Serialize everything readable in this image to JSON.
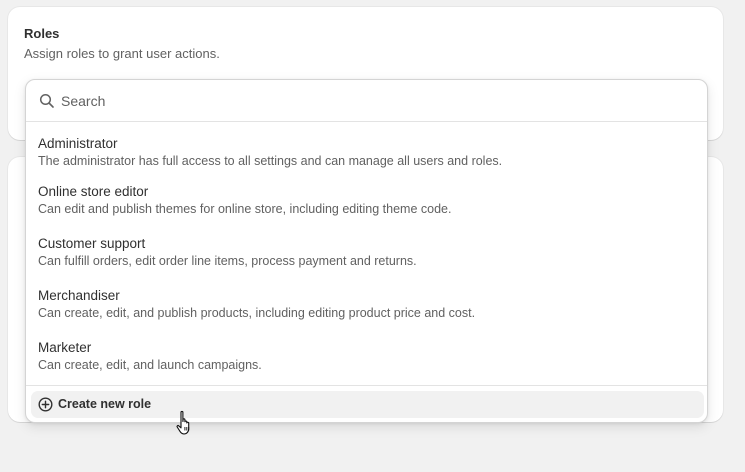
{
  "roles_card": {
    "title": "Roles",
    "subtitle": "Assign roles to grant user actions."
  },
  "search": {
    "placeholder": "Search",
    "value": ""
  },
  "roles": [
    {
      "name": "Administrator",
      "description": "The administrator has full access to all settings and can manage all users and roles."
    },
    {
      "name": "Online store editor",
      "description": "Can edit and publish themes for online store, including editing theme code."
    },
    {
      "name": "Customer support",
      "description": "Can fulfill orders, edit order line items, process payment and returns."
    },
    {
      "name": "Merchandiser",
      "description": "Can create, edit, and publish products, including editing product price and cost."
    },
    {
      "name": "Marketer",
      "description": "Can create, edit, and launch campaigns."
    }
  ],
  "create_button": {
    "label": "Create new role",
    "icon": "plus-circle-icon"
  },
  "cursor": {
    "icon": "hand-pointer-icon"
  },
  "colors": {
    "background": "#f1f1f1",
    "card": "#ffffff",
    "text_primary": "#303030",
    "text_secondary": "#616161",
    "border": "#e3e3e3"
  }
}
